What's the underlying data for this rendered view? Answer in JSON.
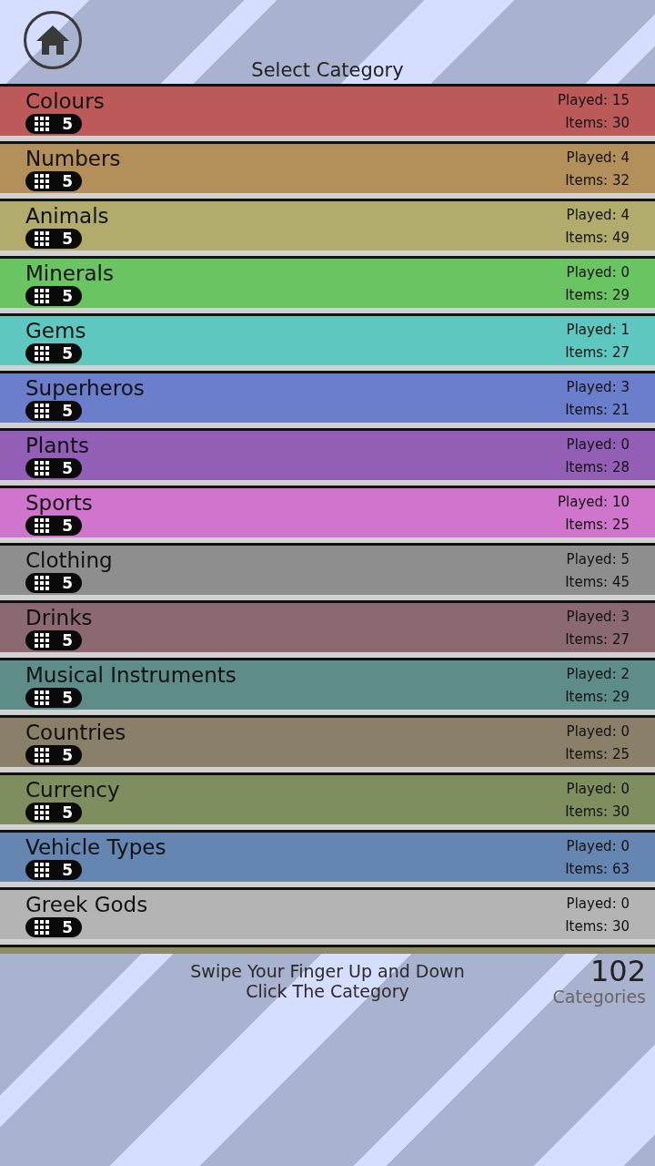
{
  "header": {
    "title": "Select Category"
  },
  "categories": [
    {
      "name": "Colours",
      "badge": "5",
      "played": "Played: 15",
      "items": "Items: 30",
      "color": "#bb5a59"
    },
    {
      "name": "Numbers",
      "badge": "5",
      "played": "Played: 4",
      "items": "Items: 32",
      "color": "#b38f5a"
    },
    {
      "name": "Animals",
      "badge": "5",
      "played": "Played: 4",
      "items": "Items: 49",
      "color": "#b1ab6c"
    },
    {
      "name": "Minerals",
      "badge": "5",
      "played": "Played: 0",
      "items": "Items: 29",
      "color": "#6bc462"
    },
    {
      "name": "Gems",
      "badge": "5",
      "played": "Played: 1",
      "items": "Items: 27",
      "color": "#5ec8c0"
    },
    {
      "name": "Superheros",
      "badge": "5",
      "played": "Played: 3",
      "items": "Items: 21",
      "color": "#6a7ecb"
    },
    {
      "name": "Plants",
      "badge": "5",
      "played": "Played: 0",
      "items": "Items: 28",
      "color": "#935fb6"
    },
    {
      "name": "Sports",
      "badge": "5",
      "played": "Played: 10",
      "items": "Items: 25",
      "color": "#d075cc"
    },
    {
      "name": "Clothing",
      "badge": "5",
      "played": "Played: 5",
      "items": "Items: 45",
      "color": "#8e8e8e"
    },
    {
      "name": "Drinks",
      "badge": "5",
      "played": "Played: 3",
      "items": "Items: 27",
      "color": "#8a6a70"
    },
    {
      "name": "Musical Instruments",
      "badge": "5",
      "played": "Played: 2",
      "items": "Items: 29",
      "color": "#5e8d89"
    },
    {
      "name": "Countries",
      "badge": "5",
      "played": "Played: 0",
      "items": "Items: 25",
      "color": "#8a7f68"
    },
    {
      "name": "Currency",
      "badge": "5",
      "played": "Played: 0",
      "items": "Items: 30",
      "color": "#7e8e5e"
    },
    {
      "name": "Vehicle Types",
      "badge": "5",
      "played": "Played: 0",
      "items": "Items: 63",
      "color": "#6686b2"
    },
    {
      "name": "Greek Gods",
      "badge": "5",
      "played": "Played: 0",
      "items": "Items: 30",
      "color": "#b4b4b4"
    }
  ],
  "partial_row": {
    "color": "#8e8c68"
  },
  "footer": {
    "hint_lines": [
      "Swipe Your Finger Up and Down",
      "Click The Category"
    ],
    "count": "102",
    "count_label": "Categories"
  }
}
